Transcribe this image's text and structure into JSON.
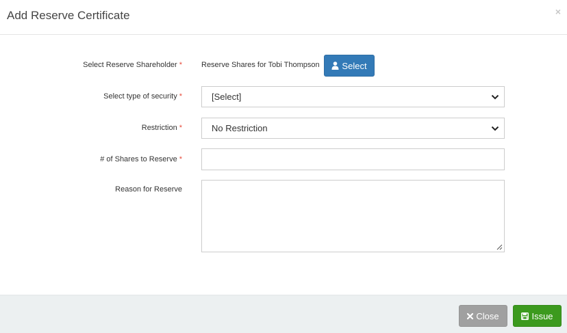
{
  "modal": {
    "title": "Add Reserve Certificate",
    "close_glyph": "×"
  },
  "form": {
    "required_mark": "*",
    "shareholder": {
      "label": "Select Reserve Shareholder",
      "value": "Reserve Shares for Tobi Thompson",
      "button_label": "Select",
      "button_icon": "user-icon"
    },
    "security_type": {
      "label": "Select type of security",
      "value": "[Select]"
    },
    "restriction": {
      "label": "Restriction",
      "value": "No Restriction"
    },
    "shares": {
      "label": "# of Shares to Reserve",
      "value": ""
    },
    "reason": {
      "label": "Reason for Reserve",
      "value": ""
    }
  },
  "footer": {
    "close_label": "Close",
    "close_icon": "times-icon",
    "issue_label": "Issue",
    "issue_icon": "save-icon"
  },
  "colors": {
    "primary": "#337ab7",
    "success": "#3c9a1e",
    "default": "#a0a0a0",
    "required": "#e74c3c",
    "footer_bg": "#ecf0f1"
  }
}
